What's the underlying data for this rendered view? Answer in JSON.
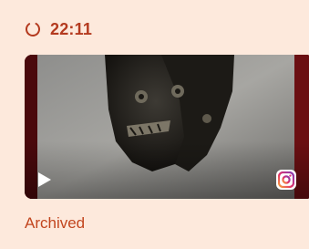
{
  "card": {
    "time_label": "22:11",
    "status_label": "Archived",
    "icons": {
      "status": "loading-spinner-icon",
      "media_type": "play-icon",
      "source": "instagram-icon"
    },
    "colors": {
      "background": "#fde9dc",
      "accent": "#b43a1f",
      "status_text": "#c2451e",
      "media_frame": "#6b0f12"
    }
  }
}
